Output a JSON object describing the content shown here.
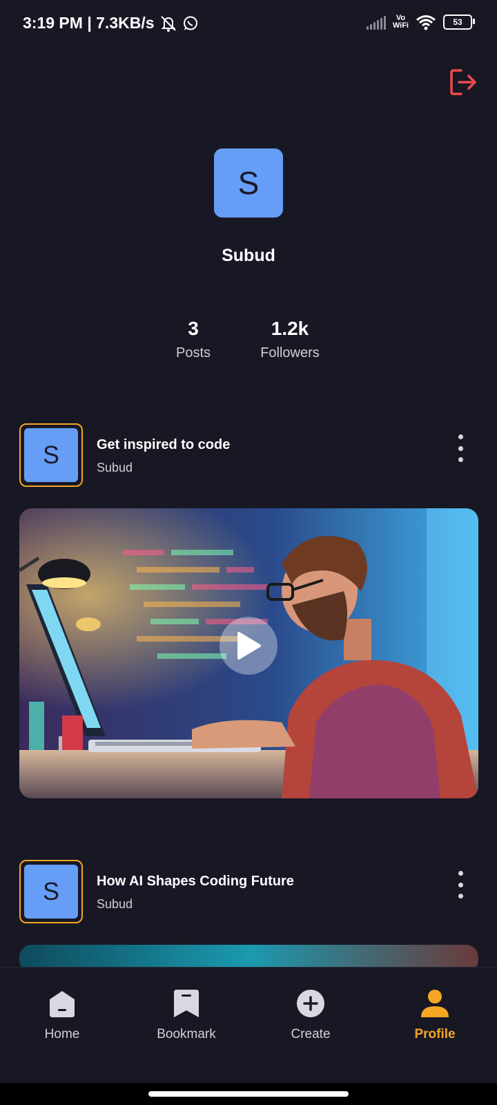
{
  "status_bar": {
    "time_speed": "3:19 PM | 7.3KB/s",
    "vowifi_top": "Vo",
    "vowifi_bottom": "WiFi",
    "battery": "53"
  },
  "profile": {
    "avatar_letter": "S",
    "name": "Subud",
    "stats": {
      "posts_count": "3",
      "posts_label": "Posts",
      "followers_count": "1.2k",
      "followers_label": "Followers"
    }
  },
  "posts": [
    {
      "avatar_letter": "S",
      "title": "Get inspired to code",
      "author": "Subud"
    },
    {
      "avatar_letter": "S",
      "title": "How AI Shapes Coding Future",
      "author": "Subud"
    }
  ],
  "nav": {
    "home": "Home",
    "bookmark": "Bookmark",
    "create": "Create",
    "profile": "Profile"
  },
  "colors": {
    "background": "#181825",
    "accent": "#f5a623",
    "avatar": "#669df6",
    "logout": "#ef4b4b"
  }
}
